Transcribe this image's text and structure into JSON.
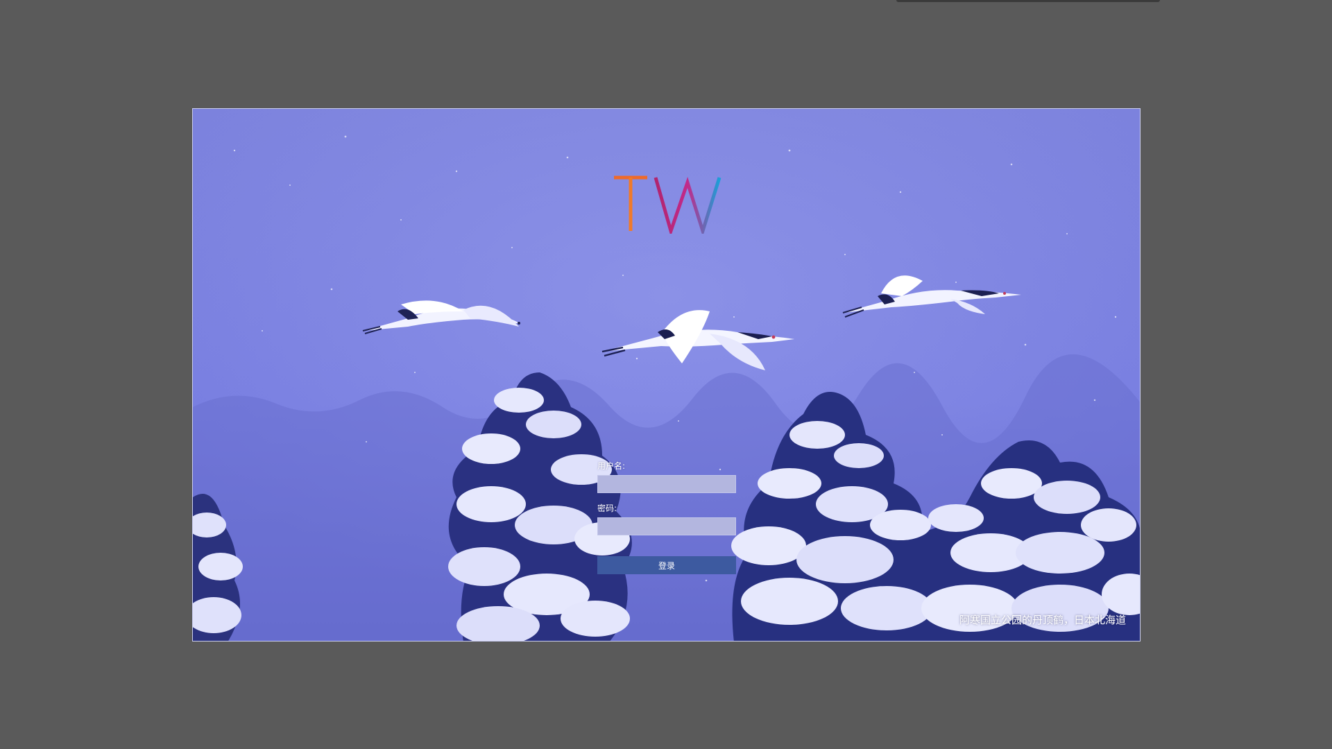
{
  "background": {
    "page_color": "#5a5a5a",
    "frame_border_color": "#c9cdf0",
    "photo_tint": "#7076d8",
    "photo_subject": "red-crowned-cranes-over-snowy-forest"
  },
  "logo": {
    "text": "TW",
    "colors": {
      "t_start": "#f07a2a",
      "t_end": "#e8502e",
      "w_left": "#b0246e",
      "w_mid": "#c22a8a",
      "w_right": "#1aa0d8"
    }
  },
  "login": {
    "username_label": "用户名:",
    "username_value": "",
    "password_label": "密码:",
    "password_value": "",
    "submit_label": "登录",
    "input_color": "#b3b6df",
    "button_color": "#3d5aa0"
  },
  "caption": {
    "text": "阿寒国立公园的丹顶鹤，日本北海道"
  }
}
